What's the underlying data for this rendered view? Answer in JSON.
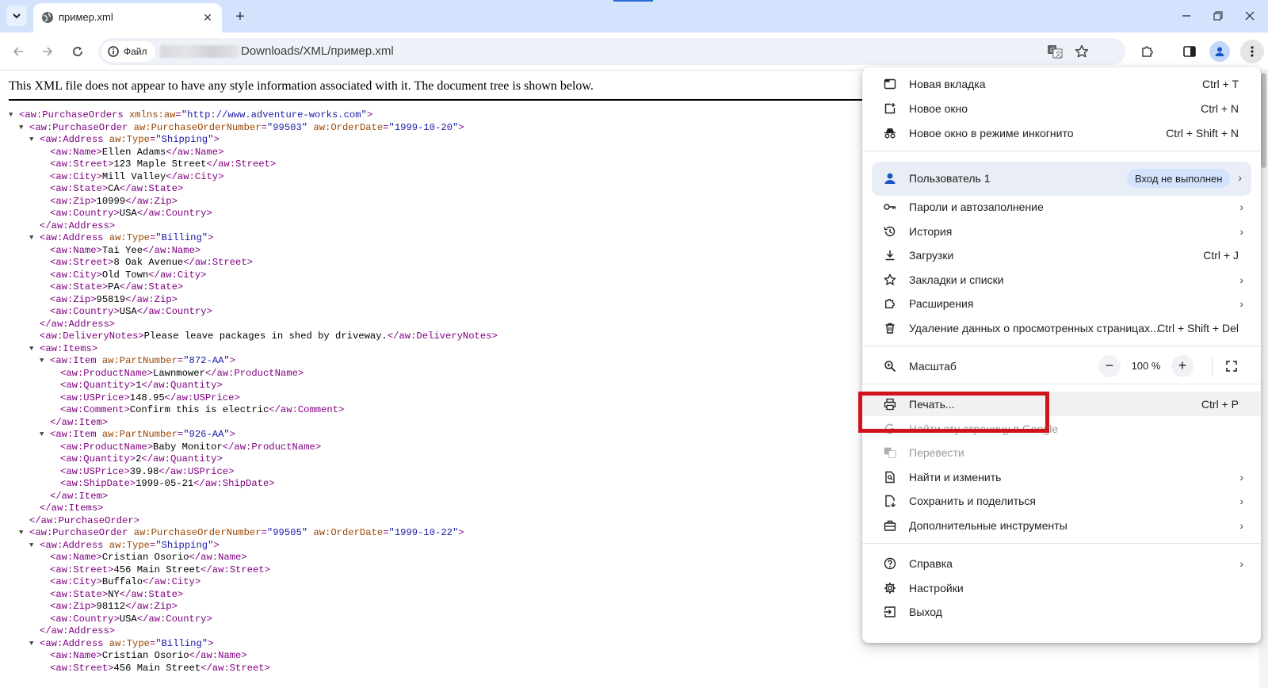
{
  "tab": {
    "title": "пример.xml",
    "close": "✕",
    "new_tab": "+"
  },
  "toolbar": {
    "site_info": "Файл",
    "url_visible": "Downloads/XML/пример.xml"
  },
  "page": {
    "xml_info": "This XML file does not appear to have any style information associated with it. The document tree is shown below.",
    "xml_lines": [
      {
        "indent": 0,
        "toggle": true,
        "parts": [
          [
            "t",
            "<aw:PurchaseOrders "
          ],
          [
            "a",
            "xmlns:aw"
          ],
          [
            "t",
            "="
          ],
          [
            "v",
            "\"http://www.adventure-works.com\""
          ],
          [
            "t",
            ">"
          ]
        ]
      },
      {
        "indent": 1,
        "toggle": true,
        "parts": [
          [
            "t",
            "<aw:PurchaseOrder "
          ],
          [
            "a",
            "aw:PurchaseOrderNumber"
          ],
          [
            "t",
            "="
          ],
          [
            "v",
            "\"99503\""
          ],
          [
            "t",
            " "
          ],
          [
            "a",
            "aw:OrderDate"
          ],
          [
            "t",
            "="
          ],
          [
            "v",
            "\"1999-10-20\""
          ],
          [
            "t",
            ">"
          ]
        ]
      },
      {
        "indent": 2,
        "toggle": true,
        "parts": [
          [
            "t",
            "<aw:Address "
          ],
          [
            "a",
            "aw:Type"
          ],
          [
            "t",
            "="
          ],
          [
            "v",
            "\"Shipping\""
          ],
          [
            "t",
            ">"
          ]
        ]
      },
      {
        "indent": 3,
        "toggle": false,
        "parts": [
          [
            "t",
            "<aw:Name>"
          ],
          [
            "x",
            "Ellen Adams"
          ],
          [
            "t",
            "</aw:Name>"
          ]
        ]
      },
      {
        "indent": 3,
        "toggle": false,
        "parts": [
          [
            "t",
            "<aw:Street>"
          ],
          [
            "x",
            "123 Maple Street"
          ],
          [
            "t",
            "</aw:Street>"
          ]
        ]
      },
      {
        "indent": 3,
        "toggle": false,
        "parts": [
          [
            "t",
            "<aw:City>"
          ],
          [
            "x",
            "Mill Valley"
          ],
          [
            "t",
            "</aw:City>"
          ]
        ]
      },
      {
        "indent": 3,
        "toggle": false,
        "parts": [
          [
            "t",
            "<aw:State>"
          ],
          [
            "x",
            "CA"
          ],
          [
            "t",
            "</aw:State>"
          ]
        ]
      },
      {
        "indent": 3,
        "toggle": false,
        "parts": [
          [
            "t",
            "<aw:Zip>"
          ],
          [
            "x",
            "10999"
          ],
          [
            "t",
            "</aw:Zip>"
          ]
        ]
      },
      {
        "indent": 3,
        "toggle": false,
        "parts": [
          [
            "t",
            "<aw:Country>"
          ],
          [
            "x",
            "USA"
          ],
          [
            "t",
            "</aw:Country>"
          ]
        ]
      },
      {
        "indent": 2,
        "toggle": false,
        "parts": [
          [
            "t",
            "</aw:Address>"
          ]
        ]
      },
      {
        "indent": 2,
        "toggle": true,
        "parts": [
          [
            "t",
            "<aw:Address "
          ],
          [
            "a",
            "aw:Type"
          ],
          [
            "t",
            "="
          ],
          [
            "v",
            "\"Billing\""
          ],
          [
            "t",
            ">"
          ]
        ]
      },
      {
        "indent": 3,
        "toggle": false,
        "parts": [
          [
            "t",
            "<aw:Name>"
          ],
          [
            "x",
            "Tai Yee"
          ],
          [
            "t",
            "</aw:Name>"
          ]
        ]
      },
      {
        "indent": 3,
        "toggle": false,
        "parts": [
          [
            "t",
            "<aw:Street>"
          ],
          [
            "x",
            "8 Oak Avenue"
          ],
          [
            "t",
            "</aw:Street>"
          ]
        ]
      },
      {
        "indent": 3,
        "toggle": false,
        "parts": [
          [
            "t",
            "<aw:City>"
          ],
          [
            "x",
            "Old Town"
          ],
          [
            "t",
            "</aw:City>"
          ]
        ]
      },
      {
        "indent": 3,
        "toggle": false,
        "parts": [
          [
            "t",
            "<aw:State>"
          ],
          [
            "x",
            "PA"
          ],
          [
            "t",
            "</aw:State>"
          ]
        ]
      },
      {
        "indent": 3,
        "toggle": false,
        "parts": [
          [
            "t",
            "<aw:Zip>"
          ],
          [
            "x",
            "95819"
          ],
          [
            "t",
            "</aw:Zip>"
          ]
        ]
      },
      {
        "indent": 3,
        "toggle": false,
        "parts": [
          [
            "t",
            "<aw:Country>"
          ],
          [
            "x",
            "USA"
          ],
          [
            "t",
            "</aw:Country>"
          ]
        ]
      },
      {
        "indent": 2,
        "toggle": false,
        "parts": [
          [
            "t",
            "</aw:Address>"
          ]
        ]
      },
      {
        "indent": 2,
        "toggle": false,
        "parts": [
          [
            "t",
            "<aw:DeliveryNotes>"
          ],
          [
            "x",
            "Please leave packages in shed by driveway."
          ],
          [
            "t",
            "</aw:DeliveryNotes>"
          ]
        ]
      },
      {
        "indent": 2,
        "toggle": true,
        "parts": [
          [
            "t",
            "<aw:Items>"
          ]
        ]
      },
      {
        "indent": 3,
        "toggle": true,
        "parts": [
          [
            "t",
            "<aw:Item "
          ],
          [
            "a",
            "aw:PartNumber"
          ],
          [
            "t",
            "="
          ],
          [
            "v",
            "\"872-AA\""
          ],
          [
            "t",
            ">"
          ]
        ]
      },
      {
        "indent": 4,
        "toggle": false,
        "parts": [
          [
            "t",
            "<aw:ProductName>"
          ],
          [
            "x",
            "Lawnmower"
          ],
          [
            "t",
            "</aw:ProductName>"
          ]
        ]
      },
      {
        "indent": 4,
        "toggle": false,
        "parts": [
          [
            "t",
            "<aw:Quantity>"
          ],
          [
            "x",
            "1"
          ],
          [
            "t",
            "</aw:Quantity>"
          ]
        ]
      },
      {
        "indent": 4,
        "toggle": false,
        "parts": [
          [
            "t",
            "<aw:USPrice>"
          ],
          [
            "x",
            "148.95"
          ],
          [
            "t",
            "</aw:USPrice>"
          ]
        ]
      },
      {
        "indent": 4,
        "toggle": false,
        "parts": [
          [
            "t",
            "<aw:Comment>"
          ],
          [
            "x",
            "Confirm this is electric"
          ],
          [
            "t",
            "</aw:Comment>"
          ]
        ]
      },
      {
        "indent": 3,
        "toggle": false,
        "parts": [
          [
            "t",
            "</aw:Item>"
          ]
        ]
      },
      {
        "indent": 3,
        "toggle": true,
        "parts": [
          [
            "t",
            "<aw:Item "
          ],
          [
            "a",
            "aw:PartNumber"
          ],
          [
            "t",
            "="
          ],
          [
            "v",
            "\"926-AA\""
          ],
          [
            "t",
            ">"
          ]
        ]
      },
      {
        "indent": 4,
        "toggle": false,
        "parts": [
          [
            "t",
            "<aw:ProductName>"
          ],
          [
            "x",
            "Baby Monitor"
          ],
          [
            "t",
            "</aw:ProductName>"
          ]
        ]
      },
      {
        "indent": 4,
        "toggle": false,
        "parts": [
          [
            "t",
            "<aw:Quantity>"
          ],
          [
            "x",
            "2"
          ],
          [
            "t",
            "</aw:Quantity>"
          ]
        ]
      },
      {
        "indent": 4,
        "toggle": false,
        "parts": [
          [
            "t",
            "<aw:USPrice>"
          ],
          [
            "x",
            "39.98"
          ],
          [
            "t",
            "</aw:USPrice>"
          ]
        ]
      },
      {
        "indent": 4,
        "toggle": false,
        "parts": [
          [
            "t",
            "<aw:ShipDate>"
          ],
          [
            "x",
            "1999-05-21"
          ],
          [
            "t",
            "</aw:ShipDate>"
          ]
        ]
      },
      {
        "indent": 3,
        "toggle": false,
        "parts": [
          [
            "t",
            "</aw:Item>"
          ]
        ]
      },
      {
        "indent": 2,
        "toggle": false,
        "parts": [
          [
            "t",
            "</aw:Items>"
          ]
        ]
      },
      {
        "indent": 1,
        "toggle": false,
        "parts": [
          [
            "t",
            "</aw:PurchaseOrder>"
          ]
        ]
      },
      {
        "indent": 1,
        "toggle": true,
        "parts": [
          [
            "t",
            "<aw:PurchaseOrder "
          ],
          [
            "a",
            "aw:PurchaseOrderNumber"
          ],
          [
            "t",
            "="
          ],
          [
            "v",
            "\"99505\""
          ],
          [
            "t",
            " "
          ],
          [
            "a",
            "aw:OrderDate"
          ],
          [
            "t",
            "="
          ],
          [
            "v",
            "\"1999-10-22\""
          ],
          [
            "t",
            ">"
          ]
        ]
      },
      {
        "indent": 2,
        "toggle": true,
        "parts": [
          [
            "t",
            "<aw:Address "
          ],
          [
            "a",
            "aw:Type"
          ],
          [
            "t",
            "="
          ],
          [
            "v",
            "\"Shipping\""
          ],
          [
            "t",
            ">"
          ]
        ]
      },
      {
        "indent": 3,
        "toggle": false,
        "parts": [
          [
            "t",
            "<aw:Name>"
          ],
          [
            "x",
            "Cristian Osorio"
          ],
          [
            "t",
            "</aw:Name>"
          ]
        ]
      },
      {
        "indent": 3,
        "toggle": false,
        "parts": [
          [
            "t",
            "<aw:Street>"
          ],
          [
            "x",
            "456 Main Street"
          ],
          [
            "t",
            "</aw:Street>"
          ]
        ]
      },
      {
        "indent": 3,
        "toggle": false,
        "parts": [
          [
            "t",
            "<aw:City>"
          ],
          [
            "x",
            "Buffalo"
          ],
          [
            "t",
            "</aw:City>"
          ]
        ]
      },
      {
        "indent": 3,
        "toggle": false,
        "parts": [
          [
            "t",
            "<aw:State>"
          ],
          [
            "x",
            "NY"
          ],
          [
            "t",
            "</aw:State>"
          ]
        ]
      },
      {
        "indent": 3,
        "toggle": false,
        "parts": [
          [
            "t",
            "<aw:Zip>"
          ],
          [
            "x",
            "98112"
          ],
          [
            "t",
            "</aw:Zip>"
          ]
        ]
      },
      {
        "indent": 3,
        "toggle": false,
        "parts": [
          [
            "t",
            "<aw:Country>"
          ],
          [
            "x",
            "USA"
          ],
          [
            "t",
            "</aw:Country>"
          ]
        ]
      },
      {
        "indent": 2,
        "toggle": false,
        "parts": [
          [
            "t",
            "</aw:Address>"
          ]
        ]
      },
      {
        "indent": 2,
        "toggle": true,
        "parts": [
          [
            "t",
            "<aw:Address "
          ],
          [
            "a",
            "aw:Type"
          ],
          [
            "t",
            "="
          ],
          [
            "v",
            "\"Billing\""
          ],
          [
            "t",
            ">"
          ]
        ]
      },
      {
        "indent": 3,
        "toggle": false,
        "parts": [
          [
            "t",
            "<aw:Name>"
          ],
          [
            "x",
            "Cristian Osorio"
          ],
          [
            "t",
            "</aw:Name>"
          ]
        ]
      },
      {
        "indent": 3,
        "toggle": false,
        "parts": [
          [
            "t",
            "<aw:Street>"
          ],
          [
            "x",
            "456 Main Street"
          ],
          [
            "t",
            "</aw:Street>"
          ]
        ]
      }
    ]
  },
  "menu": {
    "new_tab": {
      "label": "Новая вкладка",
      "shortcut": "Ctrl + T"
    },
    "new_window": {
      "label": "Новое окно",
      "shortcut": "Ctrl + N"
    },
    "incognito": {
      "label": "Новое окно в режиме инкогнито",
      "shortcut": "Ctrl + Shift + N"
    },
    "profile": {
      "label": "Пользователь 1",
      "status": "Вход не выполнен"
    },
    "passwords": {
      "label": "Пароли и автозаполнение"
    },
    "history": {
      "label": "История"
    },
    "downloads": {
      "label": "Загрузки",
      "shortcut": "Ctrl + J"
    },
    "bookmarks": {
      "label": "Закладки и списки"
    },
    "extensions": {
      "label": "Расширения"
    },
    "clear_data": {
      "label": "Удаление данных о просмотренных страницах...",
      "shortcut": "Ctrl + Shift + Del"
    },
    "zoom": {
      "label": "Масштаб",
      "minus": "−",
      "value": "100 %",
      "plus": "+"
    },
    "print": {
      "label": "Печать...",
      "shortcut": "Ctrl + P"
    },
    "search_google": {
      "label": "Найти эту страницу в Google"
    },
    "translate": {
      "label": "Перевести"
    },
    "find_edit": {
      "label": "Найти и изменить"
    },
    "save_share": {
      "label": "Сохранить и поделиться"
    },
    "more_tools": {
      "label": "Дополнительные инструменты"
    },
    "help": {
      "label": "Справка"
    },
    "settings": {
      "label": "Настройки"
    },
    "exit": {
      "label": "Выход"
    }
  },
  "colors": {
    "tabstrip": "#d3e3fd",
    "highlight_box": "#d0121c",
    "xml_tag": "#800080",
    "xml_attr_name": "#994500",
    "xml_attr_value": "#1a1aa6"
  }
}
